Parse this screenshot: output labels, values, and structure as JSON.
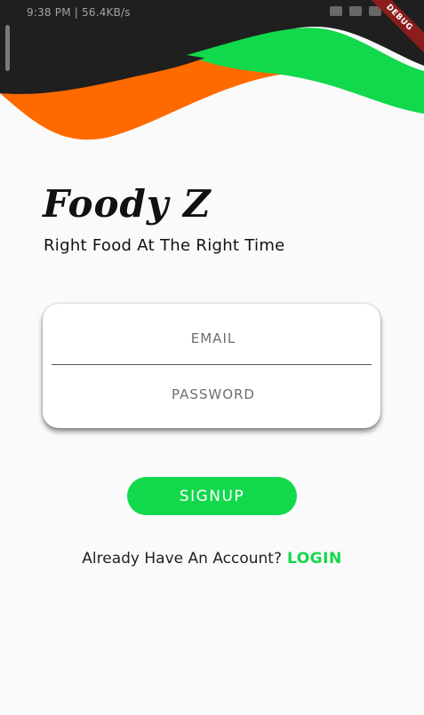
{
  "status_bar": {
    "time": "9:38 PM | 56.4KB/s"
  },
  "debug_banner": "DEBUG",
  "app": {
    "title": "Foody Z",
    "tagline": "Right Food At The Right Time"
  },
  "form": {
    "email_placeholder": "EMAIL",
    "password_placeholder": "PASSWORD"
  },
  "signup_button": "SIGNUP",
  "login_prompt": {
    "text": "Already Have An Account?",
    "link": "LOGIN"
  },
  "colors": {
    "accent_green": "#12d84c",
    "accent_orange": "#ff6a00",
    "header_dark": "#1f1f1f",
    "background": "#fafafa"
  }
}
